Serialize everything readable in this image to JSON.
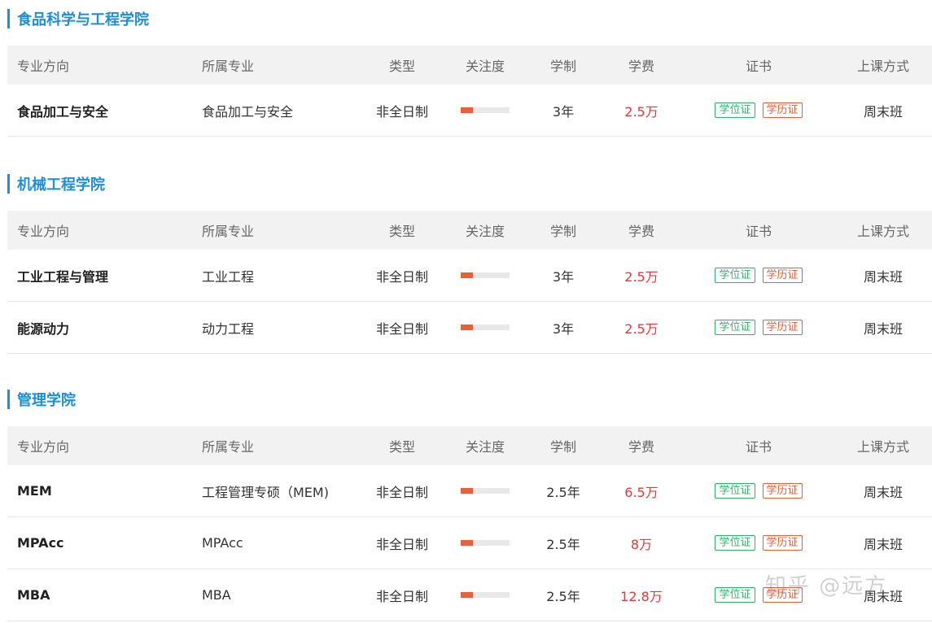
{
  "header_labels": [
    "专业方向",
    "所属专业",
    "类型",
    "关注度",
    "学制",
    "学费",
    "证书",
    "上课方式"
  ],
  "sections": [
    {
      "title": "食品科学与工程学院",
      "rows": [
        {
          "direction": "食品加工与安全",
          "major": "食品加工与安全",
          "type": "非全日制",
          "attention": 0.25,
          "duration": "3年",
          "fee": "2.5万",
          "cert1": "学位证",
          "cert2": "学历证",
          "class": "周末班"
        }
      ]
    },
    {
      "title": "机械工程学院",
      "rows": [
        {
          "direction": "工业工程与管理",
          "major": "工业工程",
          "type": "非全日制",
          "attention": 0.25,
          "duration": "3年",
          "fee": "2.5万",
          "cert1": "学位证",
          "cert2": "学历证",
          "class": "周末班"
        },
        {
          "direction": "能源动力",
          "major": "动力工程",
          "type": "非全日制",
          "attention": 0.25,
          "duration": "3年",
          "fee": "2.5万",
          "cert1": "学位证",
          "cert2": "学历证",
          "class": "周末班"
        }
      ]
    },
    {
      "title": "管理学院",
      "rows": [
        {
          "direction": "MEM",
          "major": "工程管理专硕（MEM)",
          "type": "非全日制",
          "attention": 0.25,
          "duration": "2.5年",
          "fee": "6.5万",
          "cert1": "学位证",
          "cert2": "学历证",
          "class": "周末班"
        },
        {
          "direction": "MPAcc",
          "major": "MPAcc",
          "type": "非全日制",
          "attention": 0.25,
          "duration": "2.5年",
          "fee": "8万",
          "cert1": "学位证",
          "cert2": "学历证",
          "class": "周末班"
        },
        {
          "direction": "MBA",
          "major": "MBA",
          "type": "非全日制",
          "attention": 0.25,
          "duration": "2.5年",
          "fee": "12.8万",
          "cert1": "学位证",
          "cert2": "学历证",
          "class": "周末班"
        }
      ]
    }
  ],
  "watermark": "知乎 @远方",
  "colors": {
    "accent": "#1e8fd6",
    "fee": "#e4393c",
    "bar": "#e5603b",
    "tag_green": "#2fb36b",
    "tag_red": "#e5603b"
  }
}
